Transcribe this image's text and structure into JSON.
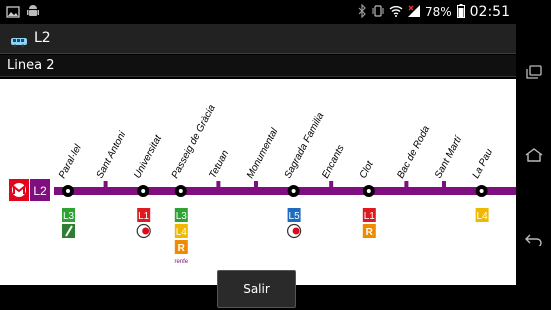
{
  "status_bar": {
    "battery": "78%",
    "time": "02:51"
  },
  "action_bar": {
    "title": "L2"
  },
  "subtitle": "Linea 2",
  "line": {
    "badge": "L2",
    "color": "#7f0f7e"
  },
  "stations": [
    {
      "name": "Paral·lel",
      "type": "major",
      "connections": [
        {
          "label": "L3",
          "color": "#2ea232",
          "kind": "line"
        },
        {
          "label": "",
          "color": "#2f7d32",
          "kind": "funicular"
        }
      ]
    },
    {
      "name": "Sant Antoni",
      "type": "minor",
      "connections": []
    },
    {
      "name": "Universitat",
      "type": "major",
      "connections": [
        {
          "label": "L1",
          "color": "#dd1a20",
          "kind": "line"
        },
        {
          "label": "",
          "color": "#333333",
          "kind": "rodalies"
        }
      ]
    },
    {
      "name": "Passeig de Gràcia",
      "type": "major",
      "connections": [
        {
          "label": "L3",
          "color": "#2ea232",
          "kind": "line"
        },
        {
          "label": "L4",
          "color": "#f0b800",
          "kind": "line"
        },
        {
          "label": "R",
          "color": "#f08a00",
          "kind": "renfe"
        },
        {
          "label": "renfe",
          "color": "#7f0f7e",
          "kind": "text"
        }
      ]
    },
    {
      "name": "Tetuan",
      "type": "minor",
      "connections": []
    },
    {
      "name": "Monumental",
      "type": "minor",
      "connections": []
    },
    {
      "name": "Sagrada Familia",
      "type": "major",
      "connections": [
        {
          "label": "L5",
          "color": "#1e6bc2",
          "kind": "line"
        },
        {
          "label": "",
          "color": "#333333",
          "kind": "rodalies"
        }
      ]
    },
    {
      "name": "Encants",
      "type": "minor",
      "connections": []
    },
    {
      "name": "Clot",
      "type": "major",
      "connections": [
        {
          "label": "L1",
          "color": "#dd1a20",
          "kind": "line"
        },
        {
          "label": "R",
          "color": "#f08a00",
          "kind": "renfe"
        }
      ]
    },
    {
      "name": "Bac de Roda",
      "type": "minor",
      "connections": []
    },
    {
      "name": "Sant Martí",
      "type": "minor",
      "connections": []
    },
    {
      "name": "La Pau",
      "type": "major",
      "connections": [
        {
          "label": "L4",
          "color": "#f0b800",
          "kind": "line"
        }
      ]
    }
  ],
  "buttons": {
    "salir": "Salir"
  }
}
